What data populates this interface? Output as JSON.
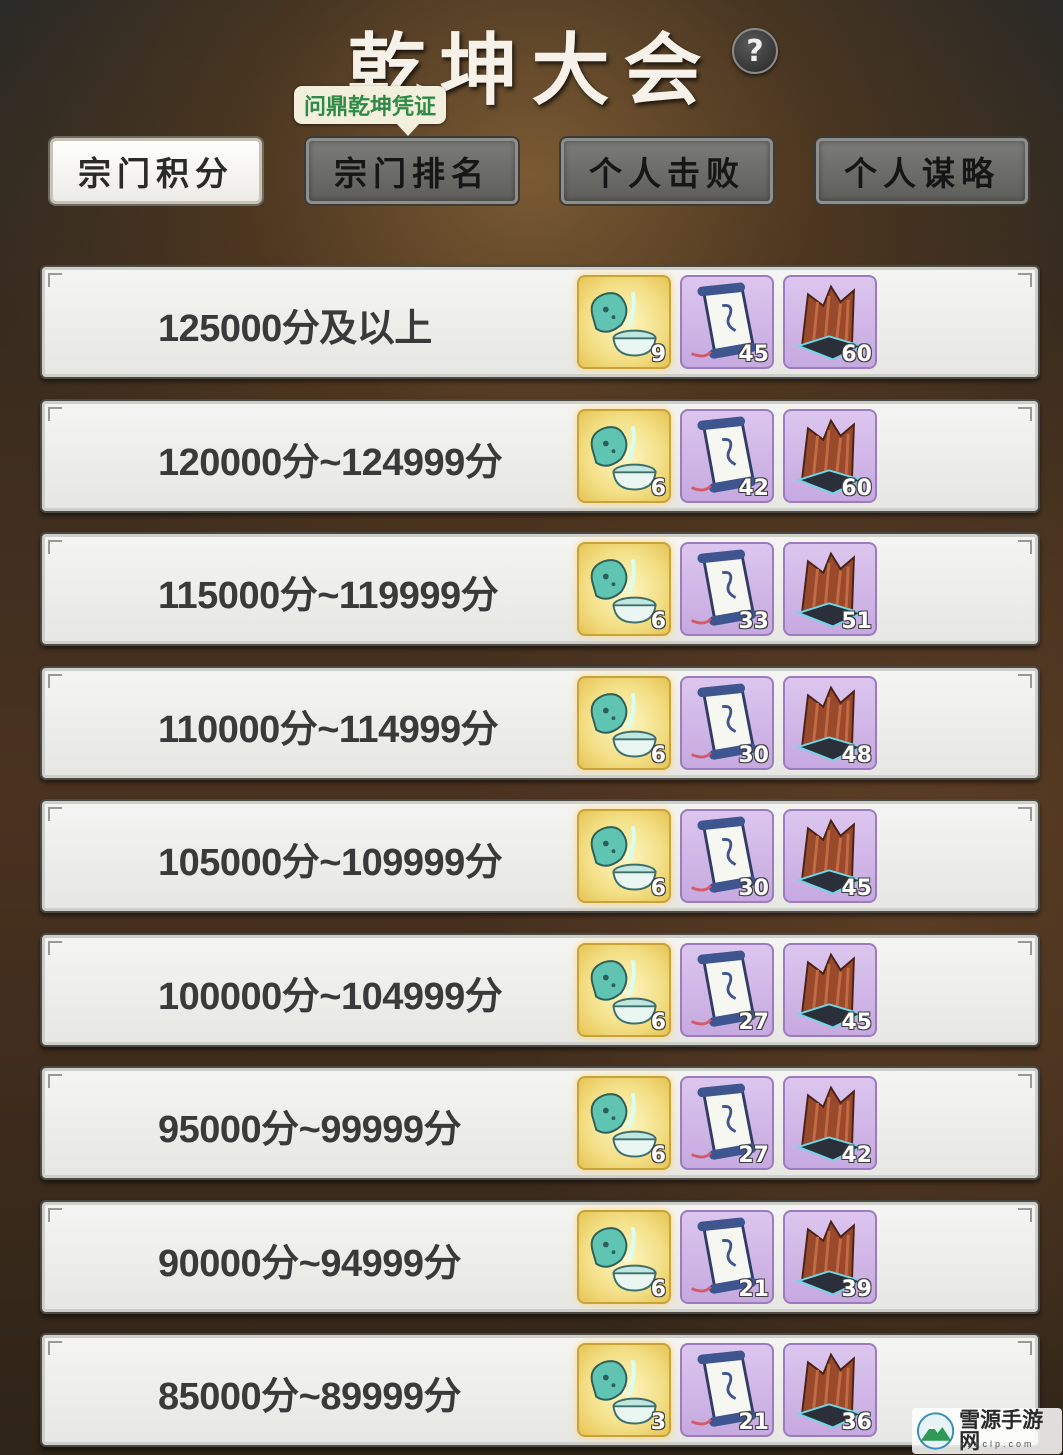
{
  "header": {
    "title": "乾坤大会",
    "help_label": "?",
    "tooltip": "问鼎乾坤凭证"
  },
  "tabs": [
    {
      "label": "宗门积分",
      "active": true
    },
    {
      "label": "宗门排名",
      "active": false
    },
    {
      "label": "个人击败",
      "active": false
    },
    {
      "label": "个人谋略",
      "active": false
    }
  ],
  "item_icons": [
    "potion-bowl-icon",
    "scroll-icon",
    "wood-bark-icon"
  ],
  "colors": {
    "gold_frame": "#f3df86",
    "purple_frame": "#c6a9e0",
    "title": "#f6f2ea",
    "tooltip_text": "#2e8a45"
  },
  "rewards": [
    {
      "range": "125000分及以上",
      "potion_qty": "9",
      "scroll_qty": "45",
      "wood_qty": "60"
    },
    {
      "range": "120000分~124999分",
      "potion_qty": "6",
      "scroll_qty": "42",
      "wood_qty": "60"
    },
    {
      "range": "115000分~119999分",
      "potion_qty": "6",
      "scroll_qty": "33",
      "wood_qty": "51"
    },
    {
      "range": "110000分~114999分",
      "potion_qty": "6",
      "scroll_qty": "30",
      "wood_qty": "48"
    },
    {
      "range": "105000分~109999分",
      "potion_qty": "6",
      "scroll_qty": "30",
      "wood_qty": "45"
    },
    {
      "range": "100000分~104999分",
      "potion_qty": "6",
      "scroll_qty": "27",
      "wood_qty": "45"
    },
    {
      "range": "95000分~99999分",
      "potion_qty": "6",
      "scroll_qty": "27",
      "wood_qty": "42"
    },
    {
      "range": "90000分~94999分",
      "potion_qty": "6",
      "scroll_qty": "21",
      "wood_qty": "39"
    },
    {
      "range": "85000分~89999分",
      "potion_qty": "3",
      "scroll_qty": "21",
      "wood_qty": "36"
    }
  ],
  "watermark": {
    "text": "雪源手游网",
    "sub": "xyzclp.com"
  }
}
